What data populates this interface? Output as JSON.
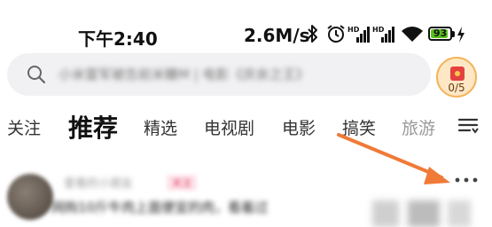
{
  "status_bar": {
    "time": "下午2:40",
    "net_speed": "2.6M/s",
    "battery_level": "93",
    "icons": [
      "bluetooth-icon",
      "alarm-icon",
      "hd-signal-icon",
      "hd-signal-icon",
      "wifi-icon",
      "battery-icon",
      "charging-icon"
    ]
  },
  "search": {
    "placeholder": "小米雷军被告前米糠M | 电影《庆余之王》",
    "task_badge": "0/5"
  },
  "tabs": [
    {
      "label": "关注",
      "active": false
    },
    {
      "label": "推荐",
      "active": true
    },
    {
      "label": "精选",
      "active": false
    },
    {
      "label": "电视剧",
      "active": false
    },
    {
      "label": "电影",
      "active": false
    },
    {
      "label": "搞笑",
      "active": false
    },
    {
      "label": "旅游",
      "active": false
    }
  ],
  "feed": {
    "author": "爱看的小朋友",
    "badge": "关注",
    "text": "网购10斤牛肉上面便宜的肉，看着过"
  },
  "colors": {
    "accent_arrow": "#f07a38",
    "battery_green": "#58c21e",
    "search_bg": "#f1f1f3"
  }
}
